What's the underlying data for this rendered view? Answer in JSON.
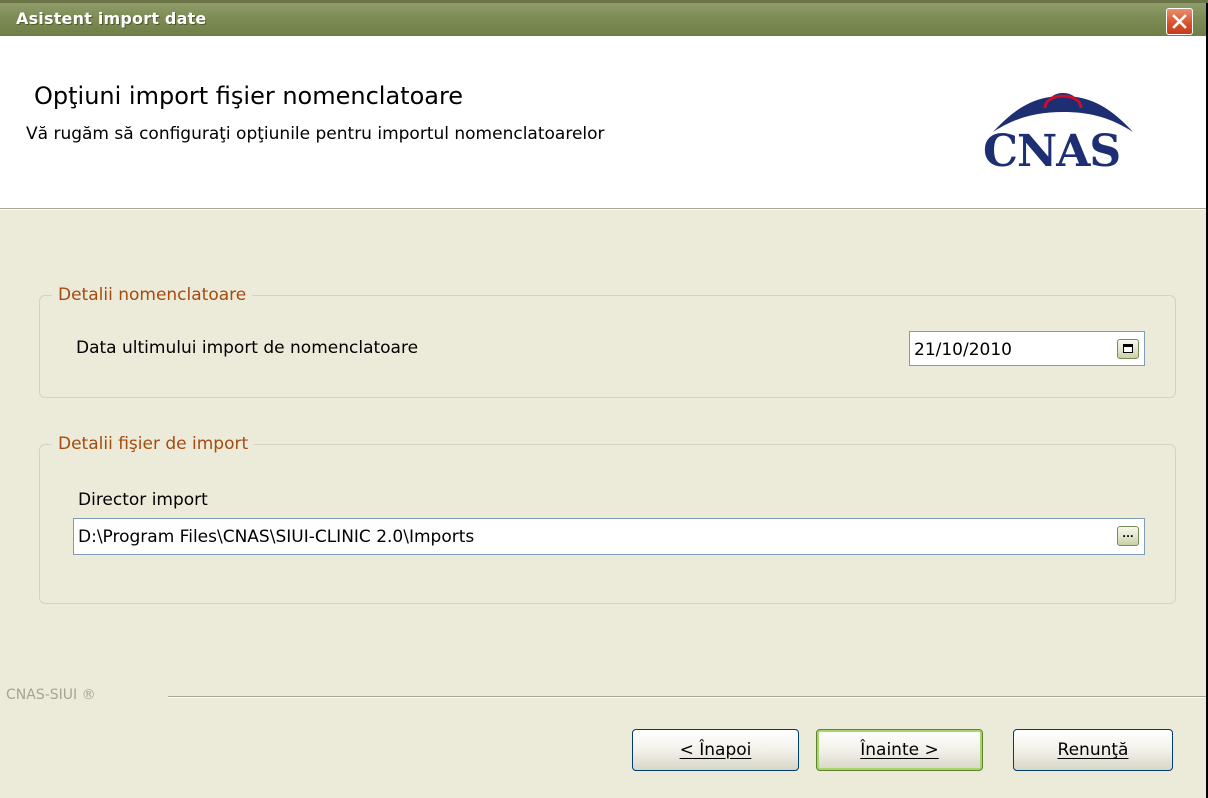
{
  "window": {
    "title": "Asistent import date"
  },
  "header": {
    "title": "Opţiuni import fişier nomenclatoare",
    "subtitle": "Vă rugăm să configuraţi opţiunile pentru importul nomenclatoarelor",
    "logo_text": "CNAS"
  },
  "group_nomenclatoare": {
    "legend": "Detalii nomenclatoare",
    "label": "Data ultimului import de nomenclatoare",
    "value": "21/10/2010"
  },
  "group_fisier": {
    "legend": "Detalii fişier de import",
    "label": "Director import",
    "value": "D:\\Program Files\\CNAS\\SIUI-CLINIC 2.0\\Imports",
    "browse_label": "..."
  },
  "footer": {
    "brand": "CNAS-SIUI ®"
  },
  "buttons": {
    "back": "< Înapoi",
    "next": "Înainte >",
    "cancel": "Renunţă"
  },
  "colors": {
    "titlebar": "#7d8c55",
    "legend": "#a34c10",
    "logo": "#1d2f72",
    "close": "#d8542e"
  },
  "icons": [
    "close-icon",
    "calendar-icon",
    "browse-icon",
    "cnas-logo-icon"
  ]
}
